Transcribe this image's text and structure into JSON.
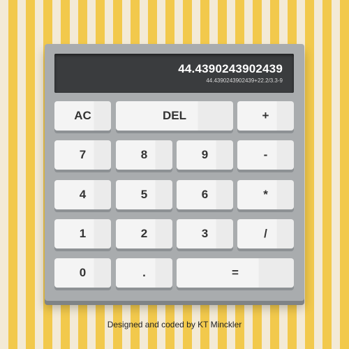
{
  "display": {
    "result": "44.4390243902439",
    "expression": "44.4390243902439+22.2/3.3-9"
  },
  "keys": {
    "ac": "AC",
    "del": "DEL",
    "plus": "+",
    "seven": "7",
    "eight": "8",
    "nine": "9",
    "minus": "-",
    "four": "4",
    "five": "5",
    "six": "6",
    "multiply": "*",
    "one": "1",
    "two": "2",
    "three": "3",
    "divide": "/",
    "zero": "0",
    "dot": ".",
    "equals": "="
  },
  "footer": {
    "credit": "Designed and coded by KT Minckler"
  },
  "colors": {
    "stripe_yellow": "#f2c94c",
    "stripe_cream": "#f3ead6",
    "body_gray": "#a9acae",
    "screen_dark": "#3a3c3e",
    "key_face": "#f4f4f4"
  }
}
